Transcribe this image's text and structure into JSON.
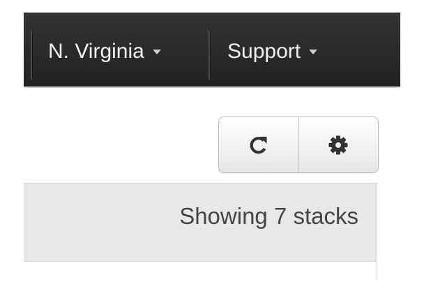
{
  "topbar": {
    "region_menu": {
      "label": "N. Virginia",
      "icon": "chevron-down-icon"
    },
    "support_menu": {
      "label": "Support",
      "icon": "chevron-down-icon"
    }
  },
  "toolbar": {
    "refresh_button": {
      "icon": "refresh-icon"
    },
    "settings_button": {
      "icon": "gear-icon"
    }
  },
  "list_header": {
    "summary_text": "Showing 7 stacks"
  },
  "colors": {
    "nav_background": "#2a2a2a",
    "nav_text": "#f2f2f2",
    "info_bar": "#e8e8e8"
  }
}
